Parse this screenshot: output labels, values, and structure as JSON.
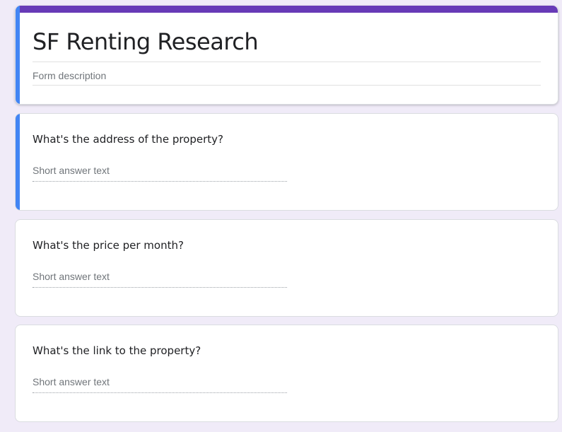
{
  "form": {
    "title": "SF Renting Research",
    "description_placeholder": "Form description"
  },
  "questions": [
    {
      "text": "What's the address of the property?",
      "answer_placeholder": "Short answer text"
    },
    {
      "text": "What's the price per month?",
      "answer_placeholder": "Short answer text"
    },
    {
      "text": "What's the link to the property?",
      "answer_placeholder": "Short answer text"
    }
  ],
  "colors": {
    "theme": "#673ab7",
    "active_indicator": "#4285f4",
    "background": "#f0ebf8"
  }
}
